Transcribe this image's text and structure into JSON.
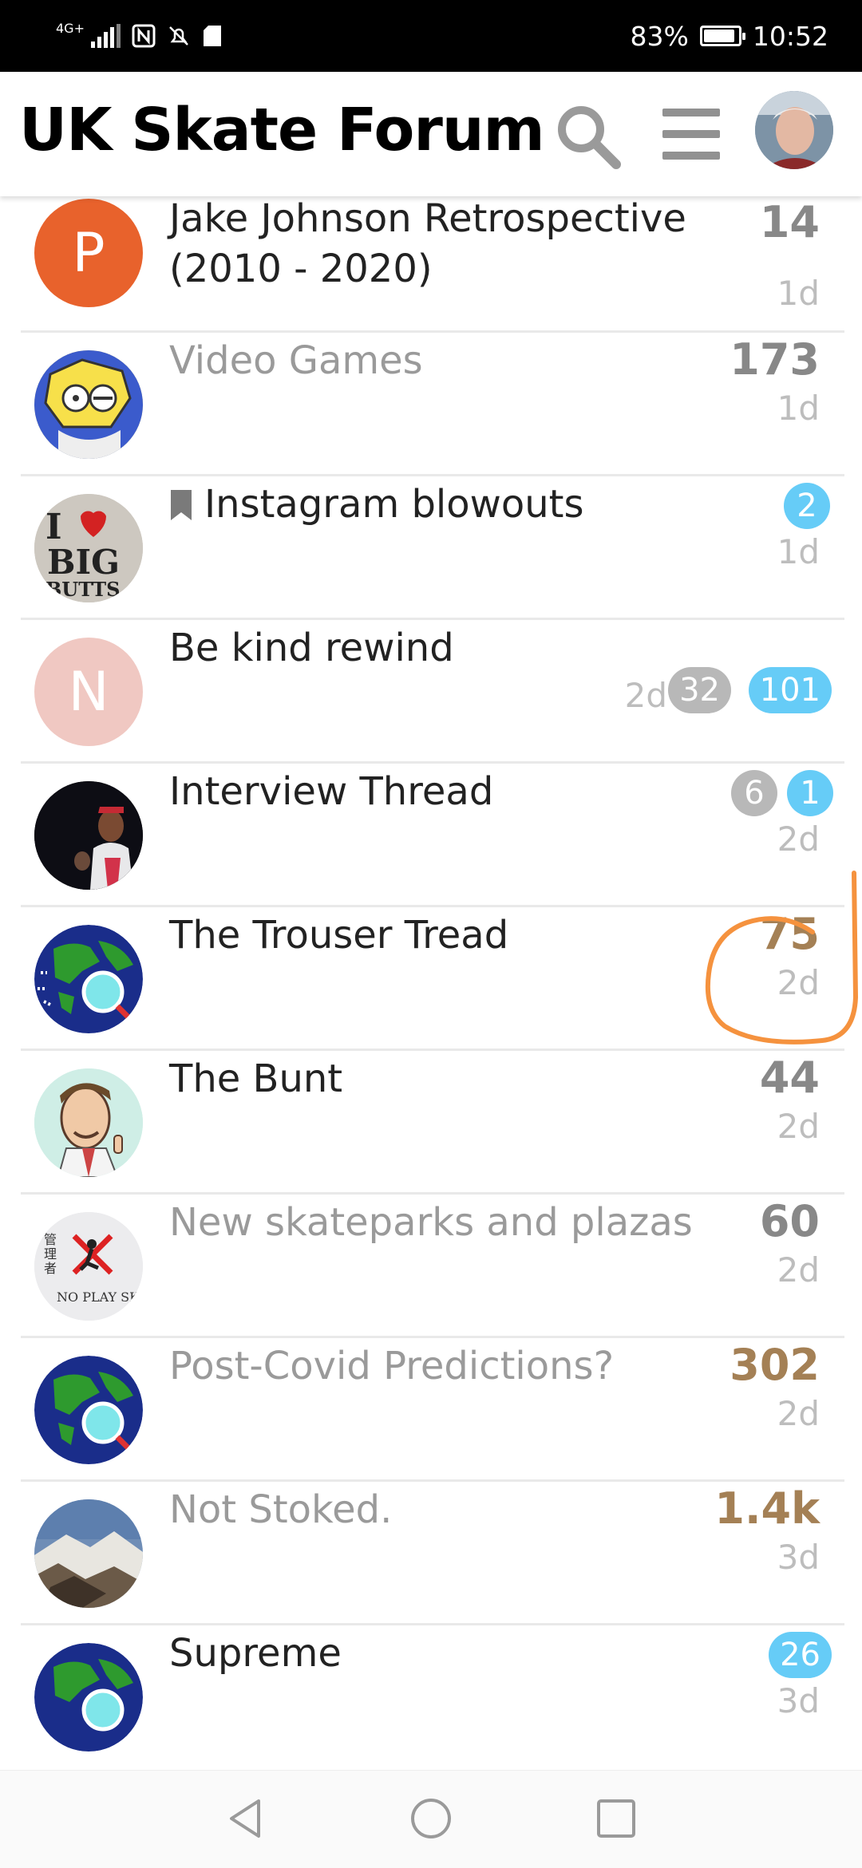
{
  "status_bar": {
    "network": "4G+",
    "battery_percent": "83%",
    "battery_level": 0.83,
    "time": "10:52"
  },
  "header": {
    "title": "UK Skate Forum"
  },
  "topics": [
    {
      "title": "Jake Johnson Retrospective (2010 - 2020)",
      "count": "14",
      "time": "1d",
      "read": false,
      "avatar_letter": "P",
      "avatar_color": "#e8622c"
    },
    {
      "title": "Video Games",
      "count": "173",
      "time": "1d",
      "read": true
    },
    {
      "title": "Instagram blowouts",
      "badge_new": "2",
      "time": "1d",
      "read": false,
      "bookmarked": true
    },
    {
      "title": "Be kind rewind",
      "time": "2d",
      "badge_unread": "32",
      "badge_new": "101",
      "read": false,
      "avatar_letter": "N",
      "avatar_color": "#f0c8c2"
    },
    {
      "title": "Interview Thread",
      "badge_unread": "6",
      "badge_new": "1",
      "time": "2d",
      "read": false
    },
    {
      "title": "The Trouser Tread",
      "count": "75",
      "time": "2d",
      "read": false
    },
    {
      "title": "The Bunt",
      "count": "44",
      "time": "2d",
      "read": false
    },
    {
      "title": "New skateparks and plazas",
      "count": "60",
      "time": "2d",
      "read": true,
      "avatar_caption": "NO PLAY SKATEBOARD"
    },
    {
      "title": "Post-Covid Predictions?",
      "count": "302",
      "time": "2d",
      "read": true
    },
    {
      "title": "Not Stoked.",
      "count": "1.4k",
      "time": "3d",
      "read": true
    },
    {
      "title": "Supreme",
      "badge_new": "26",
      "time": "3d",
      "read": false
    }
  ],
  "colors": {
    "accent_blue": "#66ccf7",
    "hot_count": "#a48055",
    "annotation": "#f5923e"
  }
}
